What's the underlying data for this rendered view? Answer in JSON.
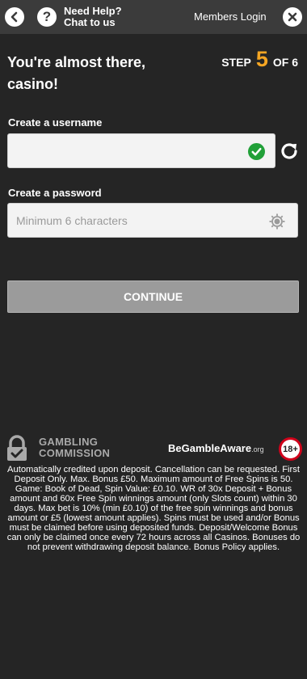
{
  "topbar": {
    "back_icon": "chevron-left-icon",
    "help_icon": "question-icon",
    "help_glyph": "?",
    "help_line1": "Need Help?",
    "help_line2": "Chat to us",
    "members_login": "Members Login",
    "close_icon": "close-icon"
  },
  "header": {
    "headline_line1": "You're almost there,",
    "headline_line2": "casino!",
    "step_prefix": "STEP",
    "step_number": "5",
    "step_suffix": "OF 6"
  },
  "form": {
    "username_label": "Create a username",
    "username_value": "",
    "username_status_icon": "check-circle-icon",
    "refresh_icon": "refresh-icon",
    "password_label": "Create a password",
    "password_placeholder": "Minimum 6 characters",
    "password_toggle_icon": "eye-icon",
    "continue_label": "CONTINUE"
  },
  "footer": {
    "gambling_commission_line1": "GAMBLING",
    "gambling_commission_line2": "COMMISSION",
    "begambleaware": "BeGambleAware",
    "begambleaware_suffix": ".org",
    "age_badge": "18+",
    "terms": "Automatically credited upon deposit. Cancellation can be requested. First Deposit Only. Max. Bonus £50. Maximum amount of Free Spins is 50. Game: Book of Dead, Spin Value: £0.10. WR of 30x Deposit + Bonus amount and 60x Free Spin winnings amount (only Slots count) within 30 days. Max bet is 10% (min £0.10) of the free spin winnings and bonus amount or £5 (lowest amount applies). Spins must be used and/or Bonus must be claimed before using deposited funds. Deposit/Welcome Bonus can only be claimed once every 72 hours across all Casinos. Bonuses do not prevent withdrawing deposit balance. Bonus Policy applies."
  },
  "colors": {
    "background": "#252525",
    "topbar": "#3b3b3b",
    "step_accent": "#f5a623",
    "check_green": "#21a038",
    "continue_disabled": "#9b9b9b",
    "age_badge_ring": "#d0021b"
  }
}
